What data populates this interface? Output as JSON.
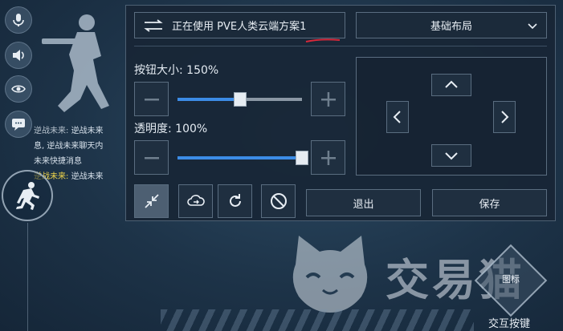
{
  "side_icons": [
    "mic-icon",
    "speaker-icon",
    "eye-icon",
    "chat-icon"
  ],
  "chat": {
    "lines": [
      {
        "name": "逆战未来:",
        "text": "逆战未来"
      },
      {
        "name": "",
        "text": "息, 逆战未来聊天内"
      },
      {
        "name": "",
        "text": "未来快捷消息"
      },
      {
        "name": "逆战未来:",
        "text": "逆战未来"
      }
    ]
  },
  "panel": {
    "scheme_label": "正在使用 PVE人类云端方案1",
    "layout_label": "基础布局",
    "size_label": "按钮大小: 150%",
    "size_fraction": 0.5,
    "opacity_label": "透明度: 100%",
    "opacity_fraction": 1.0,
    "exit_label": "退出",
    "save_label": "保存"
  },
  "watermark": {
    "text": "交易猫"
  },
  "interact": {
    "inner": "图标",
    "label": "交互按键"
  },
  "colors": {
    "accent": "#3c8ce6",
    "panel_bg": "#18263a",
    "chat_name": "#f1d64a"
  }
}
